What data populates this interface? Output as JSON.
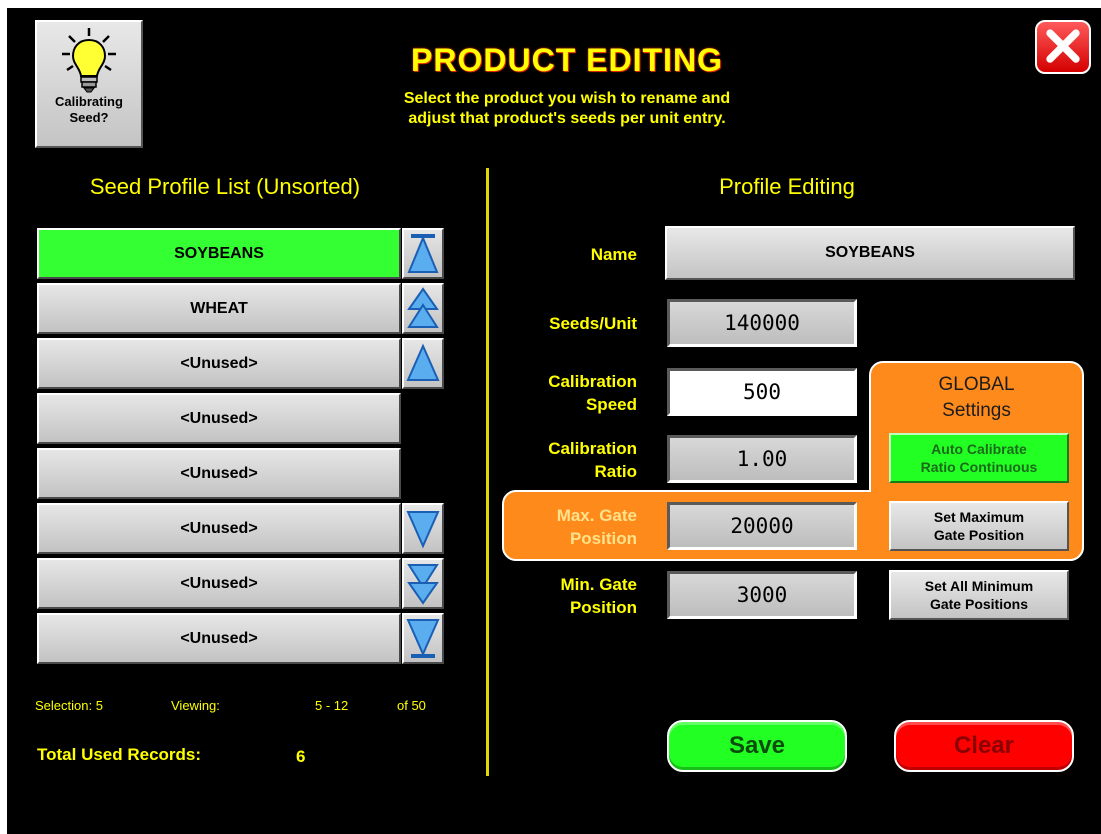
{
  "header": {
    "title": "PRODUCT EDITING",
    "subtitle_line1": "Select the product you wish to rename and",
    "subtitle_line2": "adjust that product's seeds per unit entry.",
    "calibrating_label_line1": "Calibrating",
    "calibrating_label_line2": "Seed?",
    "close_icon": "close-icon"
  },
  "left": {
    "heading": "Seed Profile List (Unsorted)",
    "items": [
      "SOYBEANS",
      "WHEAT",
      "<Unused>",
      "<Unused>",
      "<Unused>",
      "<Unused>",
      "<Unused>",
      "<Unused>"
    ],
    "selected_index": 0,
    "footer": {
      "selection_label": "Selection: 5",
      "viewing_label": "Viewing:",
      "viewing_range": "5 - 12",
      "viewing_total": "of 50",
      "total_label": "Total Used Records:",
      "total_value": "6"
    }
  },
  "right": {
    "heading": "Profile Editing",
    "name_label": "Name",
    "name_value": "SOYBEANS",
    "seeds_label": "Seeds/Unit",
    "seeds_value": "140000",
    "cal_speed_label_1": "Calibration",
    "cal_speed_label_2": "Speed",
    "cal_speed_value": "500",
    "cal_ratio_label_1": "Calibration",
    "cal_ratio_label_2": "Ratio",
    "cal_ratio_value": "1.00",
    "max_gate_label_1": "Max. Gate",
    "max_gate_label_2": "Position",
    "max_gate_value": "20000",
    "min_gate_label_1": "Min. Gate",
    "min_gate_label_2": "Position",
    "min_gate_value": "3000",
    "global_title_1": "GLOBAL",
    "global_title_2": "Settings",
    "auto_cal_1": "Auto Calibrate",
    "auto_cal_2": "Ratio Continuous",
    "set_max_1": "Set Maximum",
    "set_max_2": "Gate Position",
    "set_min_1": "Set All Minimum",
    "set_min_2": "Gate Positions",
    "save": "Save",
    "clear": "Clear"
  },
  "colors": {
    "background": "#000000",
    "text_yellow": "#ffff00",
    "selected_green": "#33ff33",
    "highlight_orange": "#ff8a1c",
    "save_green": "#22ff22",
    "clear_red": "#ff0000"
  }
}
